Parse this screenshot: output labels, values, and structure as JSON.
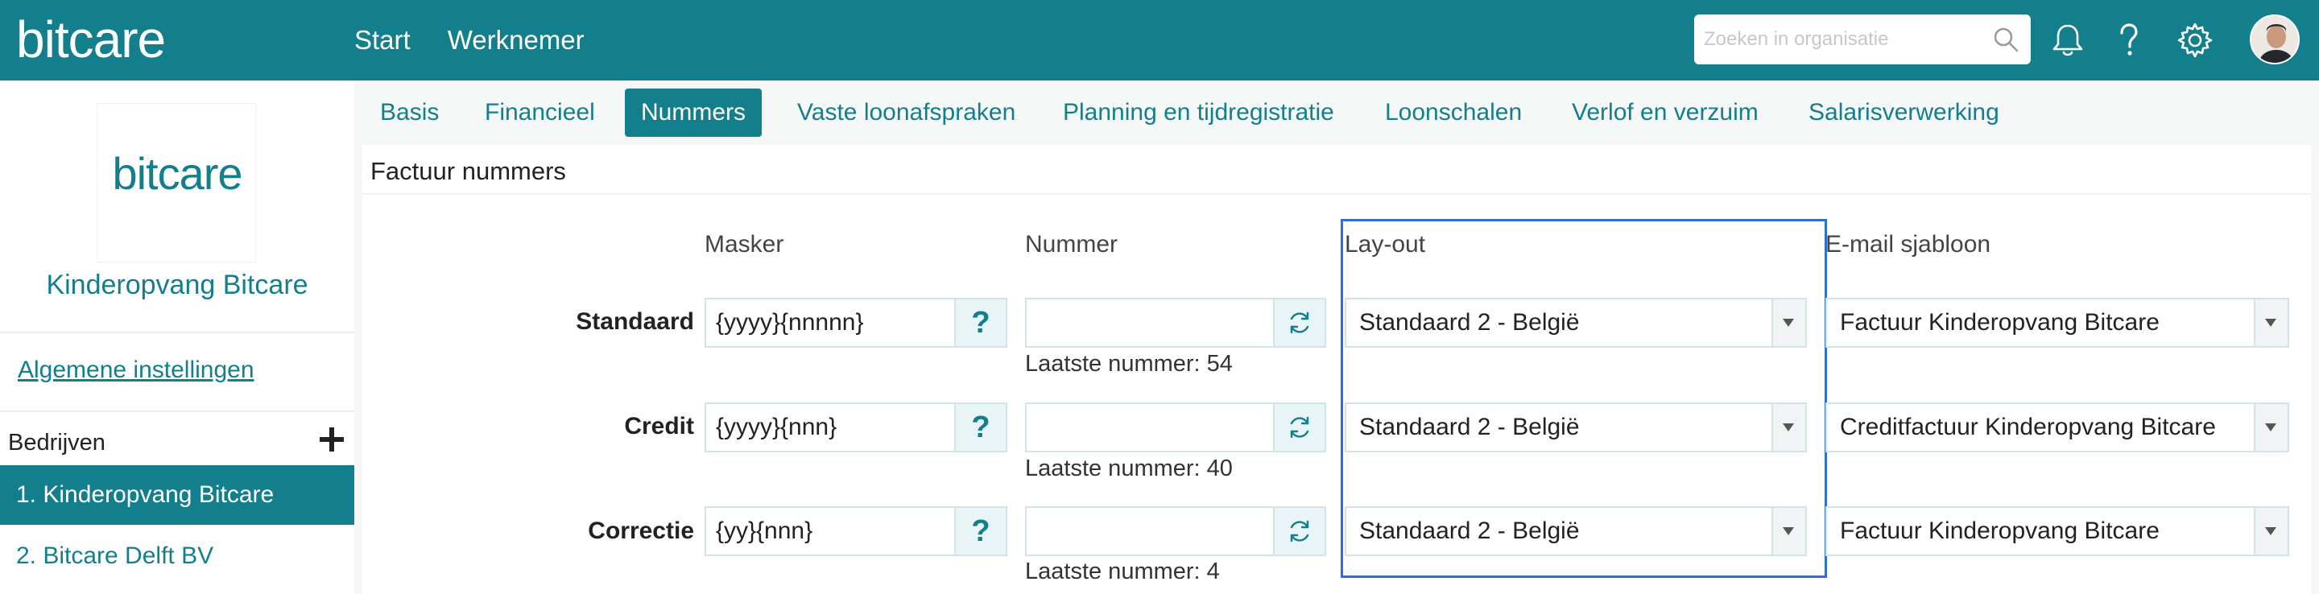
{
  "app": {
    "logo": "bitcare"
  },
  "topnav": {
    "items": [
      "Start",
      "Werknemer"
    ]
  },
  "search": {
    "placeholder": "Zoeken in organisatie"
  },
  "icons": {
    "search": "search-icon",
    "bell": "bell-icon",
    "help": "help-icon",
    "settings": "gear-icon",
    "avatar": "user-avatar"
  },
  "colors": {
    "brand": "#137e8c",
    "highlight": "#2d6fd6"
  },
  "sidebar": {
    "logo_text": "bitcare",
    "org_name": "Kinderopvang Bitcare",
    "settings_link": "Algemene instellingen",
    "companies_label": "Bedrijven",
    "companies": [
      {
        "label": "1. Kinderopvang Bitcare",
        "active": true
      },
      {
        "label": "2. Bitcare Delft BV",
        "active": false
      }
    ]
  },
  "tabs": [
    {
      "label": "Basis",
      "active": false
    },
    {
      "label": "Financieel",
      "active": false
    },
    {
      "label": "Nummers",
      "active": true
    },
    {
      "label": "Vaste loonafspraken",
      "active": false
    },
    {
      "label": "Planning en tijdregistratie",
      "active": false
    },
    {
      "label": "Loonschalen",
      "active": false
    },
    {
      "label": "Verlof en verzuim",
      "active": false
    },
    {
      "label": "Salarisverwerking",
      "active": false
    }
  ],
  "panel": {
    "title": "Factuur nummers",
    "columns": {
      "mask": "Masker",
      "number": "Nummer",
      "layout": "Lay-out",
      "email": "E-mail sjabloon"
    },
    "rows": [
      {
        "label": "Standaard",
        "mask": "{yyyy}{nnnnn}",
        "mask_help": "?",
        "number": "",
        "last_number": "Laatste nummer: 54",
        "layout": "Standaard 2 - België",
        "email_template": "Factuur Kinderopvang Bitcare"
      },
      {
        "label": "Credit",
        "mask": "{yyyy}{nnn}",
        "mask_help": "?",
        "number": "",
        "last_number": "Laatste nummer: 40",
        "layout": "Standaard 2 - België",
        "email_template": "Creditfactuur Kinderopvang Bitcare"
      },
      {
        "label": "Correctie",
        "mask": "{yy}{nnn}",
        "mask_help": "?",
        "number": "",
        "last_number": "Laatste nummer: 4",
        "layout": "Standaard 2 - België",
        "email_template": "Factuur Kinderopvang Bitcare"
      }
    ]
  }
}
